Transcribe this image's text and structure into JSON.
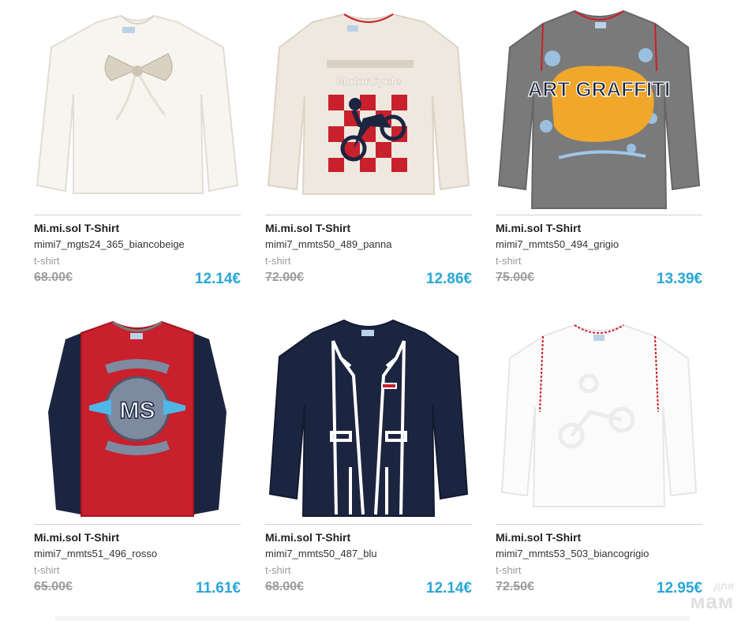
{
  "products": [
    {
      "brand": "Mi.mi.sol T-Shirt",
      "sku": "mimi7_mgts24_365_biancobeige",
      "category": "t-shirt",
      "old_price": "68.00€",
      "price": "12.14€",
      "image": "white-bow-tshirt-icon",
      "color": "#f6f4ef"
    },
    {
      "brand": "Mi.mi.sol T-Shirt",
      "sku": "mimi7_mmts50_489_panna",
      "category": "t-shirt",
      "old_price": "72.00€",
      "price": "12.86€",
      "image": "motorcycle-tshirt-icon",
      "color": "#efe8e0",
      "print": "MotorCycle"
    },
    {
      "brand": "Mi.mi.sol T-Shirt",
      "sku": "mimi7_mmts50_494_grigio",
      "category": "t-shirt",
      "old_price": "75.00€",
      "price": "13.39€",
      "image": "graffiti-tshirt-icon",
      "color": "#7c7c7c",
      "print": "ART GRAFFITI"
    },
    {
      "brand": "Mi.mi.sol T-Shirt",
      "sku": "mimi7_mmts51_496_rosso",
      "category": "t-shirt",
      "old_price": "65.00€",
      "price": "11.61€",
      "image": "ms-logo-tshirt-icon",
      "color": "#c8202c",
      "print": "MS"
    },
    {
      "brand": "Mi.mi.sol T-Shirt",
      "sku": "mimi7_mmts50_487_blu",
      "category": "t-shirt",
      "old_price": "68.00€",
      "price": "12.14€",
      "image": "jacket-print-tshirt-icon",
      "color": "#1c2540"
    },
    {
      "brand": "Mi.mi.sol T-Shirt",
      "sku": "mimi7_mmts53_503_biancogrigio",
      "category": "t-shirt",
      "old_price": "72.50€",
      "price": "12.95€",
      "image": "white-grey-tshirt-icon",
      "color": "#fbfbfb"
    }
  ],
  "watermark": {
    "line1": "для",
    "line2": "мам"
  },
  "colors": {
    "price": "#2aa6d6",
    "old_price": "#9d9d9d",
    "accent_red": "#c8202c",
    "navy": "#1c2540"
  }
}
